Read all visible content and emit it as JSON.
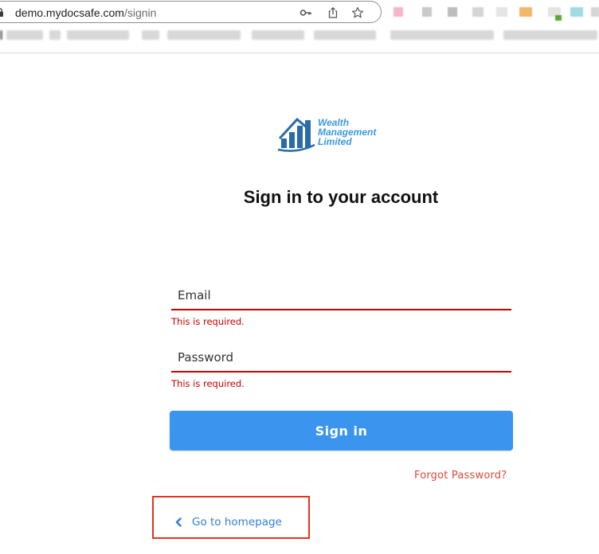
{
  "browser": {
    "url_host": "demo.mydocsafe.com",
    "url_path": "/signin",
    "icons": [
      "lock-icon",
      "key-icon",
      "share-icon",
      "star-icon"
    ]
  },
  "logo": {
    "line1": "Wealth",
    "line2": "Management",
    "line3": "Limited"
  },
  "page": {
    "title": "Sign in to your account"
  },
  "form": {
    "email_label": "Email",
    "email_error": "This is required.",
    "password_label": "Password",
    "password_error": "This is required.",
    "submit_label": "Sign in",
    "forgot_label": "Forgot Password?"
  },
  "nav": {
    "home_label": "Go to homepage",
    "home_icon": "chevron-left-icon"
  },
  "colors": {
    "primary": "#3b95ee",
    "error": "#cc0000",
    "link": "#2f80d6",
    "forgot": "#d84b3a",
    "highlight": "#e8321f"
  }
}
